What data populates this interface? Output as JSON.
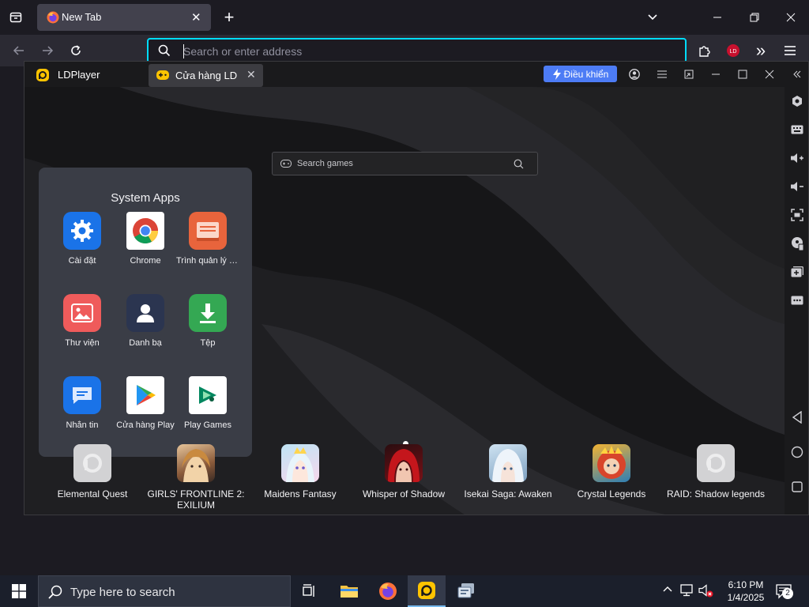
{
  "browser": {
    "tab": {
      "title": "New Tab",
      "close": "✕"
    },
    "new_tab": "+",
    "urlbar": {
      "placeholder": "Search or enter address"
    },
    "overflow": "»"
  },
  "ldplayer": {
    "app_name": "LDPlayer",
    "tab": {
      "label": "Cửa hàng LD",
      "close": "✕"
    },
    "control_button": "Điều khiển",
    "search_games": {
      "placeholder": "Search games"
    },
    "folder": {
      "title": "System Apps",
      "apps": [
        {
          "label": "Cài đặt",
          "icon": "settings-icon"
        },
        {
          "label": "Chrome",
          "icon": "chrome-icon"
        },
        {
          "label": "Trình quản lý tậ...",
          "icon": "file-manager-icon"
        },
        {
          "label": "Thư viện",
          "icon": "gallery-icon"
        },
        {
          "label": "Danh bạ",
          "icon": "contacts-icon"
        },
        {
          "label": "Tệp",
          "icon": "files-download-icon"
        },
        {
          "label": "Nhắn tin",
          "icon": "messages-icon"
        },
        {
          "label": "Cửa hàng Play",
          "icon": "play-store-icon"
        },
        {
          "label": "Play Games",
          "icon": "play-games-icon"
        }
      ]
    },
    "dock": [
      {
        "label": "Elemental Quest"
      },
      {
        "label": "GIRLS' FRONTLINE 2: EXILIUM"
      },
      {
        "label": "Maidens Fantasy"
      },
      {
        "label": "Whisper of Shadow"
      },
      {
        "label": "Isekai Saga: Awaken"
      },
      {
        "label": "Crystal Legends"
      },
      {
        "label": "RAID: Shadow legends"
      }
    ]
  },
  "taskbar": {
    "search_text": "Type here to search",
    "time": "6:10 PM",
    "date": "1/4/2025",
    "notification_count": "2"
  },
  "colors": {
    "accent": "#00ddff",
    "ld_blue": "#4d7cf5",
    "ld_yellow": "#ffc400"
  }
}
